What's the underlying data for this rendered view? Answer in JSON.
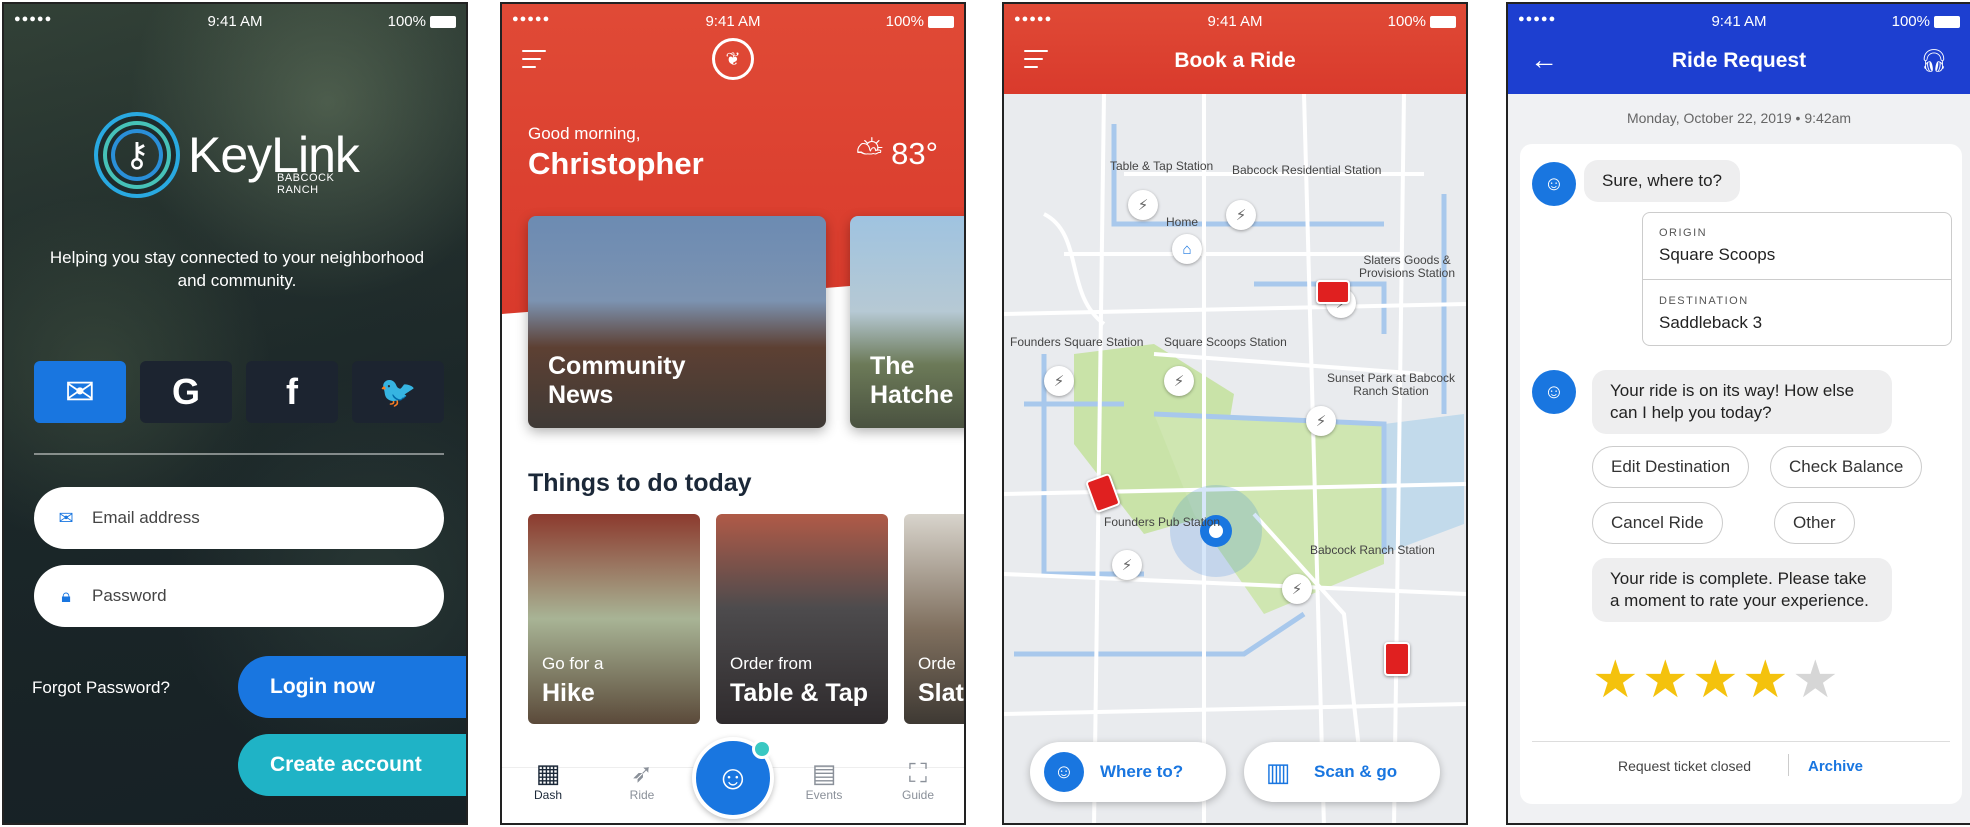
{
  "status_bar": {
    "signal": "●●●●● ",
    "time": "9:41 AM",
    "battery": "100%"
  },
  "login": {
    "logo_word": "KeyLink",
    "logo_sub": "BABCOCK RANCH",
    "tagline": "Helping you stay connected to your neighborhood and community.",
    "social": [
      {
        "icon": "mail-icon",
        "glyph": "✉"
      },
      {
        "icon": "google-icon",
        "glyph": "G"
      },
      {
        "icon": "facebook-icon",
        "glyph": "f"
      },
      {
        "icon": "twitter-icon",
        "glyph": "🐦"
      }
    ],
    "email_placeholder": "Email address",
    "password_placeholder": "Password",
    "forgot": "Forgot Password?",
    "login_button": "Login now",
    "create_button": "Create account",
    "colors": {
      "primary": "#1976e0",
      "teal": "#1fb3c6"
    }
  },
  "dash": {
    "greeting": "Good morning,",
    "name": "Christopher",
    "temperature": "83°",
    "cards": [
      {
        "title": "Community\nNews"
      },
      {
        "title": "The\nHatche"
      }
    ],
    "section_title": "Things to do today",
    "tiles": [
      {
        "small": "Go for a",
        "big": "Hike"
      },
      {
        "small": "Order from",
        "big": "Table & Tap"
      },
      {
        "small": "Orde",
        "big": "Slat"
      }
    ],
    "tabs": [
      {
        "label": "Dash",
        "icon": "grid-icon"
      },
      {
        "label": "Ride",
        "icon": "ride-icon"
      },
      {
        "label": "Events",
        "icon": "calendar-icon"
      },
      {
        "label": "Guide",
        "icon": "map-icon"
      }
    ],
    "colors": {
      "hero": "#d93a2c",
      "dark": "#1b2838"
    }
  },
  "ride": {
    "title": "Book a Ride",
    "stations": [
      {
        "label": "Table & Tap\nStation"
      },
      {
        "label": "Babcock Residential\nStation"
      },
      {
        "label": "Home"
      },
      {
        "label": "Slaters Goods &\nProvisions Station"
      },
      {
        "label": "Founders Square\nStation"
      },
      {
        "label": "Square Scoops\nStation"
      },
      {
        "label": "Sunset Park at Babcock\nRanch Station"
      },
      {
        "label": "Founders Pub\nStation"
      },
      {
        "label": "Babcock Ranch\nStation"
      }
    ],
    "where_to": "Where to?",
    "scan_go": "Scan & go"
  },
  "request": {
    "title": "Ride Request",
    "date": "Monday, October 22, 2019  •  9:42am",
    "msg1": "Sure, where to?",
    "origin_label": "ORIGIN",
    "origin": "Square Scoops",
    "destination_label": "DESTINATION",
    "destination": "Saddleback 3",
    "msg2": "Your ride is on its way! How else can I help you today?",
    "chips": [
      "Edit Destination",
      "Check Balance",
      "Cancel Ride",
      "Other"
    ],
    "msg3": "Your ride is complete. Please take a moment to rate your experience.",
    "rating": 4,
    "rating_max": 5,
    "closed": "Request ticket closed",
    "archive": "Archive",
    "colors": {
      "header": "#1d3fd0",
      "star": "#f4c20d"
    }
  }
}
